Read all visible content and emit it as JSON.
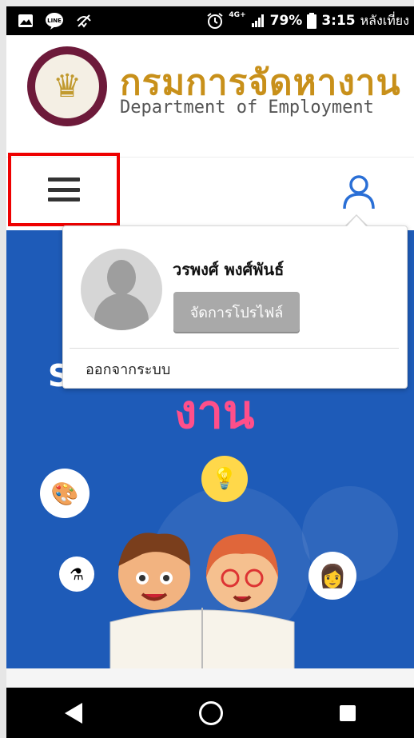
{
  "status_bar": {
    "battery": "79%",
    "time": "3:15",
    "time_suffix": "หลังเที่ยง",
    "network": "4G+",
    "line_app": "LINE"
  },
  "header": {
    "brand_th": "กรมการจัดหางาน",
    "brand_en": "Department of Employment"
  },
  "hero": {
    "title_fragment": "งาน",
    "side_letter": "S"
  },
  "popup": {
    "username": "วรพงศ์ พงศ์พันธ์",
    "manage_profile": "จัดการโปรไฟล์",
    "logout": "ออกจากระบบ"
  },
  "colors": {
    "brand": "#c8901a",
    "hero_bg": "#1e5bb8",
    "highlight": "#e00000",
    "button_gray": "#a9a9a9"
  },
  "icons": [
    "image-icon",
    "line-icon",
    "location-off-icon",
    "alarm-icon",
    "signal-icon",
    "battery-icon",
    "hamburger-menu-icon",
    "user-icon",
    "back-icon",
    "home-icon",
    "recents-icon"
  ]
}
